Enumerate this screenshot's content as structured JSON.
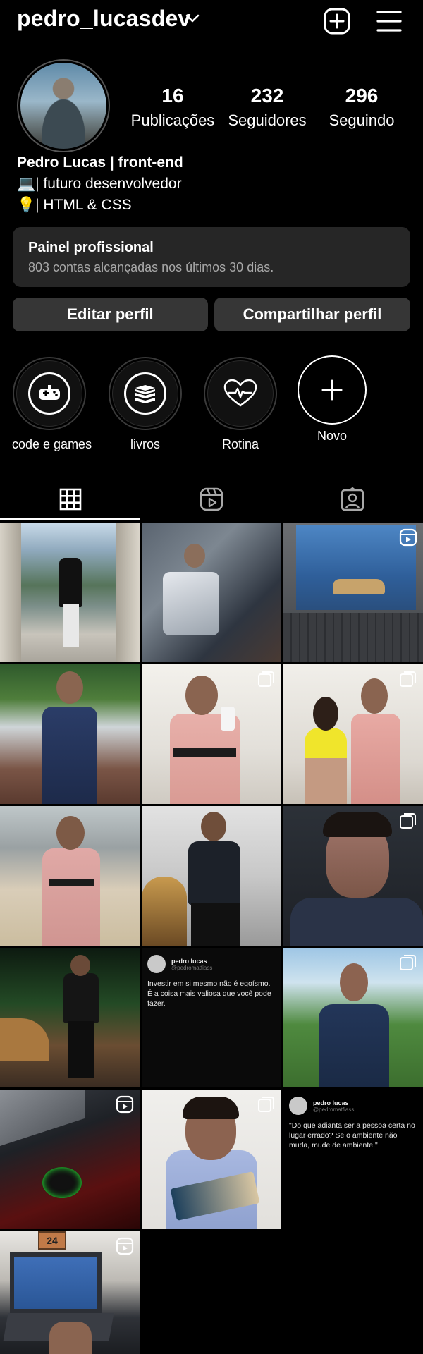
{
  "header": {
    "username": "pedro_lucasdev",
    "icons": [
      "chevron-down-icon",
      "add-post-icon",
      "menu-icon"
    ]
  },
  "profile": {
    "stats": [
      {
        "value": "16",
        "label": "Publicações"
      },
      {
        "value": "232",
        "label": "Seguidores"
      },
      {
        "value": "296",
        "label": "Seguindo"
      }
    ],
    "name": "Pedro Lucas | front-end",
    "bio_line1": "💻| futuro desenvolvedor",
    "bio_line2": "💡| HTML & CSS"
  },
  "panel": {
    "title": "Painel profissional",
    "subtitle": "803 contas alcançadas nos últimos 30 dias."
  },
  "buttons": {
    "edit": "Editar perfil",
    "share": "Compartilhar perfil"
  },
  "highlights": [
    {
      "label": "code e games",
      "icon": "gamepad-icon"
    },
    {
      "label": "livros",
      "icon": "books-icon"
    },
    {
      "label": "Rotina",
      "icon": "heartbeat-icon"
    },
    {
      "label": "Novo",
      "icon": "plus-icon"
    }
  ],
  "tabs": [
    "grid-icon",
    "reels-icon",
    "tagged-icon"
  ],
  "grid": {
    "tweet1": {
      "name": "pedro lucas",
      "handle": "@pedromatfiass",
      "text": "Investir em si mesmo não é egoísmo. É a coisa mais valiosa que você pode fazer."
    },
    "tweet2": {
      "name": "pedro lucas",
      "handle": "@pedromatfiass",
      "text": "\"Do que adianta ser a pessoa certa no lugar errado? Se o ambiente não muda, mude de ambiente.\""
    },
    "last_photo_text": "24"
  },
  "colors": {
    "background": "#000000",
    "panel": "#262626",
    "button": "#363636",
    "muted_text": "#a8a8a8"
  }
}
